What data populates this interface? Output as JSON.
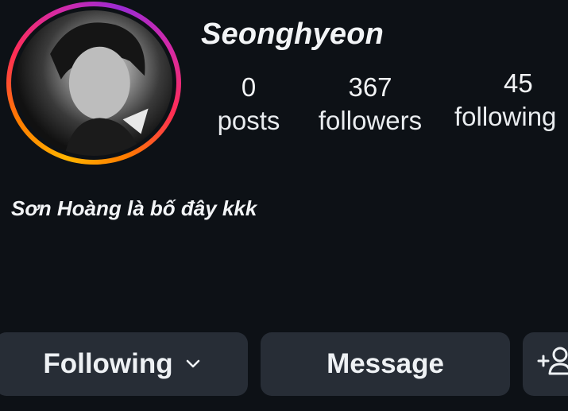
{
  "profile": {
    "username": "Seonghyeon",
    "bio": "Sơn Hoàng là bố đây kkk"
  },
  "stats": {
    "posts": {
      "value": "0",
      "label": "posts"
    },
    "followers": {
      "value": "367",
      "label": "followers"
    },
    "following": {
      "value": "45",
      "label": "following"
    }
  },
  "actions": {
    "following_label": "Following",
    "message_label": "Message"
  },
  "icons": {
    "dropdown": "chevron-down-icon",
    "add_user": "add-user-icon"
  },
  "colors": {
    "background": "#0d1116",
    "button_bg": "#272d36",
    "story_ring": [
      "#ffb400",
      "#ff2d55",
      "#9b2bd4"
    ]
  }
}
